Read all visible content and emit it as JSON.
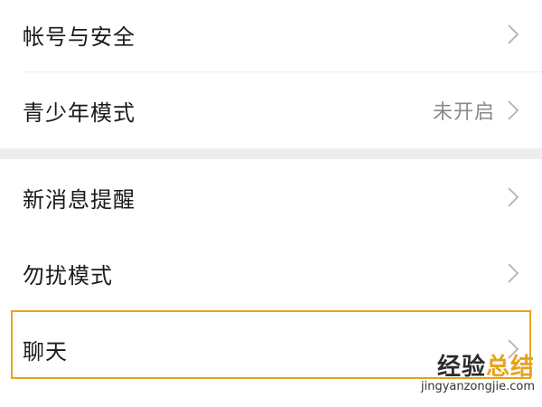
{
  "settings": {
    "group1": [
      {
        "label": "帐号与安全",
        "value": ""
      },
      {
        "label": "青少年模式",
        "value": "未开启"
      }
    ],
    "group2": [
      {
        "label": "新消息提醒",
        "value": ""
      },
      {
        "label": "勿扰模式",
        "value": ""
      },
      {
        "label": "聊天",
        "value": ""
      }
    ]
  },
  "watermark": {
    "title_part1": "经验",
    "title_part2": "总结",
    "url": "jingyanzongjie.com"
  },
  "colors": {
    "highlight": "#e8a21a",
    "chevron": "#b2b2b2",
    "section_gap": "#ededed"
  },
  "icons": {
    "row_arrow": "chevron-right-icon"
  }
}
